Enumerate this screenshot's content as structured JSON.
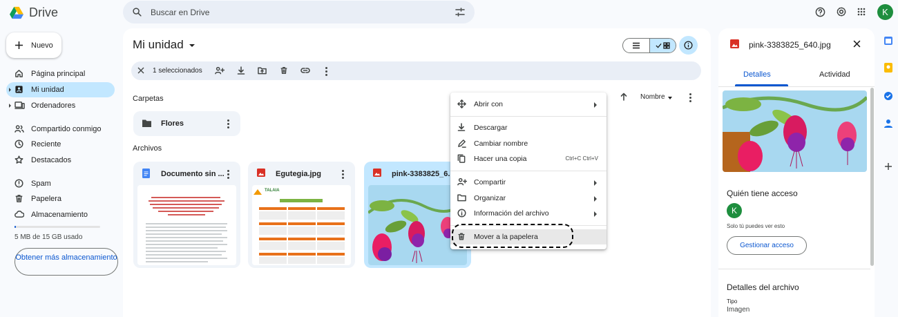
{
  "app": {
    "name": "Drive"
  },
  "search": {
    "placeholder": "Buscar en Drive"
  },
  "header": {
    "avatar_letter": "K"
  },
  "sidebar": {
    "new_label": "Nuevo",
    "items": [
      {
        "label": "Página principal"
      },
      {
        "label": "Mi unidad"
      },
      {
        "label": "Ordenadores"
      },
      {
        "label": "Compartido conmigo"
      },
      {
        "label": "Reciente"
      },
      {
        "label": "Destacados"
      },
      {
        "label": "Spam"
      },
      {
        "label": "Papelera"
      },
      {
        "label": "Almacenamiento"
      }
    ],
    "storage_text": "5 MB de 15 GB usado",
    "storage_fraction": 0.0003,
    "get_more_label": "Obtener más almacenamiento"
  },
  "main": {
    "title": "Mi unidad",
    "selection_text": "1 seleccionados",
    "folders_heading": "Carpetas",
    "files_heading": "Archivos",
    "folder": {
      "name": "Flores"
    },
    "files": [
      {
        "name": "Documento sin ...",
        "type": "doc"
      },
      {
        "name": "Egutegia.jpg",
        "type": "image"
      },
      {
        "name": "pink-3383825_6...",
        "type": "image",
        "selected": true
      }
    ],
    "sort_label": "Nombre",
    "thumb_talaia": "TALAIA"
  },
  "context_menu": {
    "items": [
      {
        "label": "Abrir con",
        "submenu": true
      },
      {
        "label": "Descargar"
      },
      {
        "label": "Cambiar nombre"
      },
      {
        "label": "Hacer una copia",
        "shortcut": "Ctrl+C Ctrl+V"
      },
      {
        "label": "Compartir",
        "submenu": true
      },
      {
        "label": "Organizar",
        "submenu": true
      },
      {
        "label": "Información del archivo",
        "submenu": true
      },
      {
        "label": "Mover a la papelera"
      }
    ]
  },
  "details_panel": {
    "file_name": "pink-3383825_640.jpg",
    "tab_details": "Detalles",
    "tab_activity": "Actividad",
    "access_heading": "Quién tiene acceso",
    "avatar_letter": "K",
    "only_you": "Solo tú puedes ver esto",
    "manage_label": "Gestionar acceso",
    "file_details_heading": "Detalles del archivo",
    "type_label": "Tipo",
    "type_value": "Imagen"
  },
  "colors": {
    "accent": "#0b57d0",
    "selected": "#c2e7ff",
    "avatar": "#1e8e3e"
  }
}
